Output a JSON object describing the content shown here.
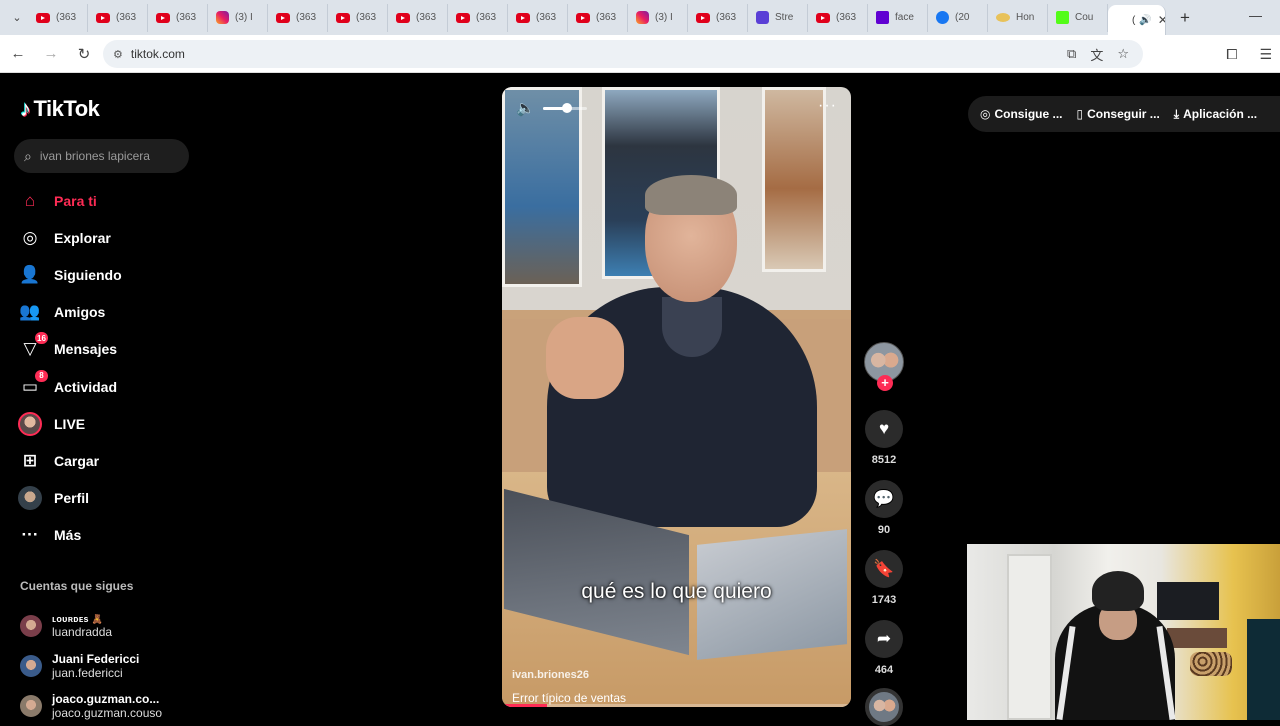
{
  "browser": {
    "tabs": [
      {
        "icon": "yt",
        "label": "(363"
      },
      {
        "icon": "yt",
        "label": "(363"
      },
      {
        "icon": "yt",
        "label": "(363"
      },
      {
        "icon": "ig",
        "label": "(3) I"
      },
      {
        "icon": "yt",
        "label": "(363"
      },
      {
        "icon": "yt",
        "label": "(363"
      },
      {
        "icon": "yt",
        "label": "(363"
      },
      {
        "icon": "yt",
        "label": "(363"
      },
      {
        "icon": "yt",
        "label": "(363"
      },
      {
        "icon": "yt",
        "label": "(363"
      },
      {
        "icon": "ig",
        "label": "(3) I"
      },
      {
        "icon": "yt",
        "label": "(363"
      },
      {
        "icon": "stream",
        "label": "Stre"
      },
      {
        "icon": "yt",
        "label": "(363"
      },
      {
        "icon": "yahoo",
        "label": "face"
      },
      {
        "icon": "fb",
        "label": "(20"
      },
      {
        "icon": "hon",
        "label": "Hon"
      },
      {
        "icon": "k",
        "label": "Cou"
      }
    ],
    "active_tab_label": "(",
    "url": "tiktok.com"
  },
  "tiktok": {
    "logo": "TikTok",
    "search_query": "ivan briones lapicera",
    "nav": [
      {
        "id": "para-ti",
        "label": "Para ti",
        "icon": "home-icon",
        "active": true,
        "badge": ""
      },
      {
        "id": "explorar",
        "label": "Explorar",
        "icon": "compass-icon",
        "active": false,
        "badge": ""
      },
      {
        "id": "siguiendo",
        "label": "Siguiendo",
        "icon": "following-icon",
        "active": false,
        "badge": ""
      },
      {
        "id": "amigos",
        "label": "Amigos",
        "icon": "friends-icon",
        "active": false,
        "badge": ""
      },
      {
        "id": "mensajes",
        "label": "Mensajes",
        "icon": "send-icon",
        "active": false,
        "badge": "16"
      },
      {
        "id": "actividad",
        "label": "Actividad",
        "icon": "activity-icon",
        "active": false,
        "badge": "8"
      },
      {
        "id": "live",
        "label": "LIVE",
        "icon": "live-avatar",
        "active": false,
        "badge": ""
      },
      {
        "id": "cargar",
        "label": "Cargar",
        "icon": "upload-icon",
        "active": false,
        "badge": ""
      },
      {
        "id": "perfil",
        "label": "Perfil",
        "icon": "profile-avatar",
        "active": false,
        "badge": ""
      },
      {
        "id": "mas",
        "label": "Más",
        "icon": "more-icon",
        "active": false,
        "badge": ""
      }
    ],
    "following_title": "Cuentas que sigues",
    "following": [
      {
        "name": "ʟᴏᴜʀᴅᴇs 🧸",
        "handle": "luandradda",
        "color": "#7a3e4a",
        "small": true
      },
      {
        "name": "Juani Federicci",
        "handle": "juan.federicci",
        "color": "#3a5b8a",
        "small": false
      },
      {
        "name": "joaco.guzman.co...",
        "handle": "joaco.guzman.couso",
        "color": "#8a7a6a",
        "small": false
      }
    ],
    "video": {
      "caption": "qué es lo que quiero",
      "author": "ivan.briones26",
      "description": "Error típico de ventas",
      "progress": 0.13,
      "volume": 0.55
    },
    "actions": {
      "likes": "8512",
      "comments": "90",
      "saves": "1743",
      "shares": "464"
    },
    "top_buttons": [
      "Consigue ...",
      "Conseguir ...",
      "Aplicación ..."
    ]
  },
  "colors": {
    "accent": "#fe2c55",
    "background": "#000000"
  }
}
